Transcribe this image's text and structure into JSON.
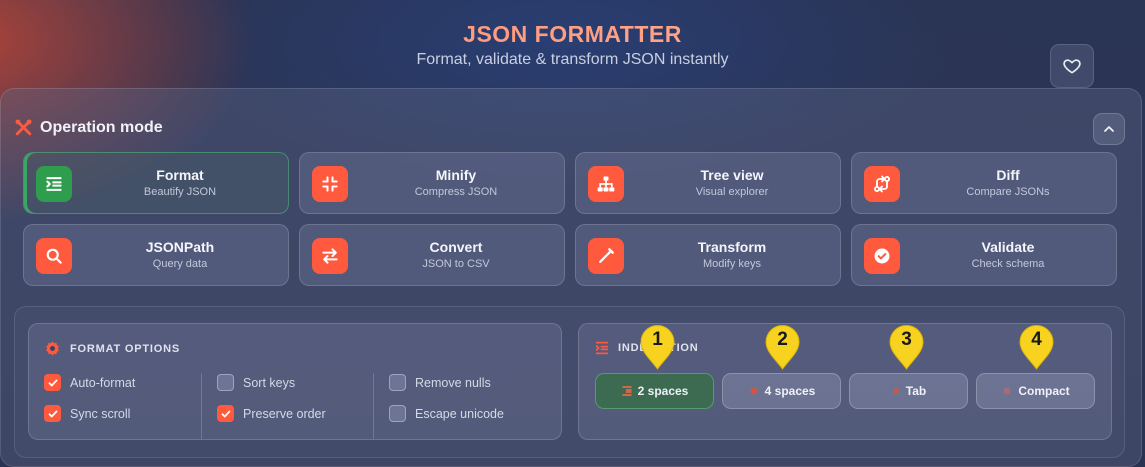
{
  "header": {
    "title": "JSON FORMATTER",
    "subtitle": "Format, validate & transform JSON instantly"
  },
  "icons": {
    "favorite": "heart-icon",
    "operation_mode": "tools-icon",
    "collapse": "chevron-up-icon",
    "format_options": "gear-icon",
    "indentation": "indent-icon"
  },
  "operation_mode": {
    "label": "Operation mode",
    "modes": [
      {
        "title": "Format",
        "subtitle": "Beautify JSON",
        "icon": "indent-icon",
        "active": true
      },
      {
        "title": "Minify",
        "subtitle": "Compress JSON",
        "icon": "compress-icon",
        "active": false
      },
      {
        "title": "Tree view",
        "subtitle": "Visual explorer",
        "icon": "sitemap-icon",
        "active": false
      },
      {
        "title": "Diff",
        "subtitle": "Compare JSONs",
        "icon": "diff-icon",
        "active": false
      },
      {
        "title": "JSONPath",
        "subtitle": "Query data",
        "icon": "search-icon",
        "active": false
      },
      {
        "title": "Convert",
        "subtitle": "JSON to CSV",
        "icon": "swap-icon",
        "active": false
      },
      {
        "title": "Transform",
        "subtitle": "Modify keys",
        "icon": "pen-icon",
        "active": false
      },
      {
        "title": "Validate",
        "subtitle": "Check schema",
        "icon": "check-circle-icon",
        "active": false
      }
    ]
  },
  "format_options": {
    "title": "FORMAT OPTIONS",
    "options": [
      {
        "label": "Auto-format",
        "checked": true
      },
      {
        "label": "Sync scroll",
        "checked": true
      },
      {
        "label": "Sort keys",
        "checked": false
      },
      {
        "label": "Preserve order",
        "checked": true
      },
      {
        "label": "Remove nulls",
        "checked": false
      },
      {
        "label": "Escape unicode",
        "checked": false
      }
    ]
  },
  "indentation": {
    "title": "INDENTATION",
    "title_visible": [
      "INDE",
      "NTATION"
    ],
    "buttons": [
      {
        "label": "2 spaces",
        "selected": true
      },
      {
        "label": "4 spaces",
        "selected": false
      },
      {
        "label": "Tab",
        "selected": false
      },
      {
        "label": "Compact",
        "selected": false
      }
    ]
  },
  "annotations": {
    "markers": [
      "1",
      "2",
      "3",
      "4"
    ],
    "color": "#f7d31f"
  },
  "colors": {
    "accent": "#ff5a3d",
    "active_green": "#2e9d4e",
    "title_gradient": [
      "#ff8a6a",
      "#ffb49a"
    ]
  }
}
